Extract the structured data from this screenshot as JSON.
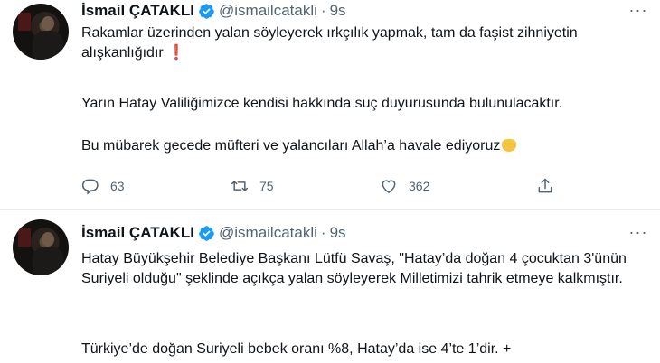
{
  "tweets": [
    {
      "author": {
        "name": "İsmail ÇATAKLI",
        "handle": "@ismailcatakli",
        "time": "9s"
      },
      "paragraphs": [
        "Rakamlar üzerinden yalan söyleyerek ırkçılık yapmak, tam da faşist zihniyetin alışkanlığıdır",
        "Yarın Hatay Valiliğimizce kendisi hakkında suç duyurusunda bulunulacaktır.",
        "Bu mübarek gecede müfteri ve yalancıları Allah’a havale ediyoruz"
      ],
      "exclamation_emoji": "❗",
      "actions": {
        "replies": "63",
        "retweets": "75",
        "likes": "362"
      }
    },
    {
      "author": {
        "name": "İsmail ÇATAKLI",
        "handle": "@ismailcatakli",
        "time": "9s"
      },
      "paragraphs": [
        "Hatay Büyükşehir Belediye Başkanı Lütfü Savaş, \"Hatay’da doğan 4 çocuktan 3'ünün Suriyeli olduğu\" şeklinde açıkça yalan söyleyerek Milletimizi tahrik etmeye kalkmıştır.",
        "Türkiye’de doğan Suriyeli bebek oranı %8, Hatay’da ise 4’te 1’dir. +"
      ]
    }
  ],
  "colors": {
    "verified": "#1d9bf0",
    "muted": "#536471",
    "divider": "#e6ecf0"
  },
  "icons": {
    "verified": "verified-badge-icon",
    "more": "more-icon",
    "reply": "reply-icon",
    "retweet": "retweet-icon",
    "like": "heart-icon",
    "share": "share-icon",
    "emoji_hands": "open-hands-emoji"
  }
}
